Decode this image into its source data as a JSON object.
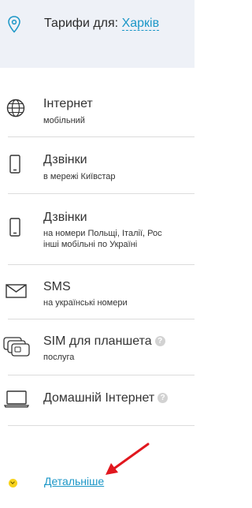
{
  "header": {
    "tariffs_label": "Тарифи для:",
    "city": "Харків",
    "location_icon": "location-pin-icon"
  },
  "menu": {
    "items": [
      {
        "title": "Інтернет",
        "subtitle": "мобільний",
        "icon": "globe-icon"
      },
      {
        "title": "Дзвінки",
        "subtitle": "в мережі Київстар",
        "icon": "phone-icon"
      },
      {
        "title": "Дзвінки",
        "subtitle_line1": "на номери Польщі, Італії, Рос",
        "subtitle_line2": "інші мобільні по Україні",
        "icon": "phone-icon"
      },
      {
        "title": "SMS",
        "subtitle": "на українські номери",
        "icon": "envelope-icon"
      },
      {
        "title": "SIM для планшета",
        "subtitle": "послуга",
        "help": "?",
        "icon": "sim-cards-icon"
      },
      {
        "title": "Домашній Інтернет",
        "help": "?",
        "icon": "laptop-icon"
      }
    ]
  },
  "details": {
    "label": "Детальніше",
    "icon": "chevron-down-icon"
  },
  "colors": {
    "accent": "#1c97c7",
    "header_bg": "#eef1f7",
    "details_dot": "#f7d21c",
    "annotation_arrow": "#e1171e"
  }
}
